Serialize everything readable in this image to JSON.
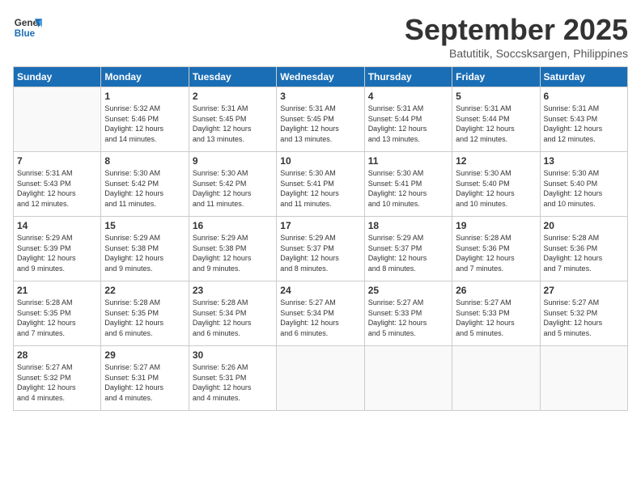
{
  "logo": {
    "line1": "General",
    "line2": "Blue"
  },
  "title": "September 2025",
  "subtitle": "Batutitik, Soccsksargen, Philippines",
  "days_of_week": [
    "Sunday",
    "Monday",
    "Tuesday",
    "Wednesday",
    "Thursday",
    "Friday",
    "Saturday"
  ],
  "weeks": [
    [
      {
        "num": "",
        "info": ""
      },
      {
        "num": "1",
        "info": "Sunrise: 5:32 AM\nSunset: 5:46 PM\nDaylight: 12 hours\nand 14 minutes."
      },
      {
        "num": "2",
        "info": "Sunrise: 5:31 AM\nSunset: 5:45 PM\nDaylight: 12 hours\nand 13 minutes."
      },
      {
        "num": "3",
        "info": "Sunrise: 5:31 AM\nSunset: 5:45 PM\nDaylight: 12 hours\nand 13 minutes."
      },
      {
        "num": "4",
        "info": "Sunrise: 5:31 AM\nSunset: 5:44 PM\nDaylight: 12 hours\nand 13 minutes."
      },
      {
        "num": "5",
        "info": "Sunrise: 5:31 AM\nSunset: 5:44 PM\nDaylight: 12 hours\nand 12 minutes."
      },
      {
        "num": "6",
        "info": "Sunrise: 5:31 AM\nSunset: 5:43 PM\nDaylight: 12 hours\nand 12 minutes."
      }
    ],
    [
      {
        "num": "7",
        "info": "Sunrise: 5:31 AM\nSunset: 5:43 PM\nDaylight: 12 hours\nand 12 minutes."
      },
      {
        "num": "8",
        "info": "Sunrise: 5:30 AM\nSunset: 5:42 PM\nDaylight: 12 hours\nand 11 minutes."
      },
      {
        "num": "9",
        "info": "Sunrise: 5:30 AM\nSunset: 5:42 PM\nDaylight: 12 hours\nand 11 minutes."
      },
      {
        "num": "10",
        "info": "Sunrise: 5:30 AM\nSunset: 5:41 PM\nDaylight: 12 hours\nand 11 minutes."
      },
      {
        "num": "11",
        "info": "Sunrise: 5:30 AM\nSunset: 5:41 PM\nDaylight: 12 hours\nand 10 minutes."
      },
      {
        "num": "12",
        "info": "Sunrise: 5:30 AM\nSunset: 5:40 PM\nDaylight: 12 hours\nand 10 minutes."
      },
      {
        "num": "13",
        "info": "Sunrise: 5:30 AM\nSunset: 5:40 PM\nDaylight: 12 hours\nand 10 minutes."
      }
    ],
    [
      {
        "num": "14",
        "info": "Sunrise: 5:29 AM\nSunset: 5:39 PM\nDaylight: 12 hours\nand 9 minutes."
      },
      {
        "num": "15",
        "info": "Sunrise: 5:29 AM\nSunset: 5:38 PM\nDaylight: 12 hours\nand 9 minutes."
      },
      {
        "num": "16",
        "info": "Sunrise: 5:29 AM\nSunset: 5:38 PM\nDaylight: 12 hours\nand 9 minutes."
      },
      {
        "num": "17",
        "info": "Sunrise: 5:29 AM\nSunset: 5:37 PM\nDaylight: 12 hours\nand 8 minutes."
      },
      {
        "num": "18",
        "info": "Sunrise: 5:29 AM\nSunset: 5:37 PM\nDaylight: 12 hours\nand 8 minutes."
      },
      {
        "num": "19",
        "info": "Sunrise: 5:28 AM\nSunset: 5:36 PM\nDaylight: 12 hours\nand 7 minutes."
      },
      {
        "num": "20",
        "info": "Sunrise: 5:28 AM\nSunset: 5:36 PM\nDaylight: 12 hours\nand 7 minutes."
      }
    ],
    [
      {
        "num": "21",
        "info": "Sunrise: 5:28 AM\nSunset: 5:35 PM\nDaylight: 12 hours\nand 7 minutes."
      },
      {
        "num": "22",
        "info": "Sunrise: 5:28 AM\nSunset: 5:35 PM\nDaylight: 12 hours\nand 6 minutes."
      },
      {
        "num": "23",
        "info": "Sunrise: 5:28 AM\nSunset: 5:34 PM\nDaylight: 12 hours\nand 6 minutes."
      },
      {
        "num": "24",
        "info": "Sunrise: 5:27 AM\nSunset: 5:34 PM\nDaylight: 12 hours\nand 6 minutes."
      },
      {
        "num": "25",
        "info": "Sunrise: 5:27 AM\nSunset: 5:33 PM\nDaylight: 12 hours\nand 5 minutes."
      },
      {
        "num": "26",
        "info": "Sunrise: 5:27 AM\nSunset: 5:33 PM\nDaylight: 12 hours\nand 5 minutes."
      },
      {
        "num": "27",
        "info": "Sunrise: 5:27 AM\nSunset: 5:32 PM\nDaylight: 12 hours\nand 5 minutes."
      }
    ],
    [
      {
        "num": "28",
        "info": "Sunrise: 5:27 AM\nSunset: 5:32 PM\nDaylight: 12 hours\nand 4 minutes."
      },
      {
        "num": "29",
        "info": "Sunrise: 5:27 AM\nSunset: 5:31 PM\nDaylight: 12 hours\nand 4 minutes."
      },
      {
        "num": "30",
        "info": "Sunrise: 5:26 AM\nSunset: 5:31 PM\nDaylight: 12 hours\nand 4 minutes."
      },
      {
        "num": "",
        "info": ""
      },
      {
        "num": "",
        "info": ""
      },
      {
        "num": "",
        "info": ""
      },
      {
        "num": "",
        "info": ""
      }
    ]
  ]
}
